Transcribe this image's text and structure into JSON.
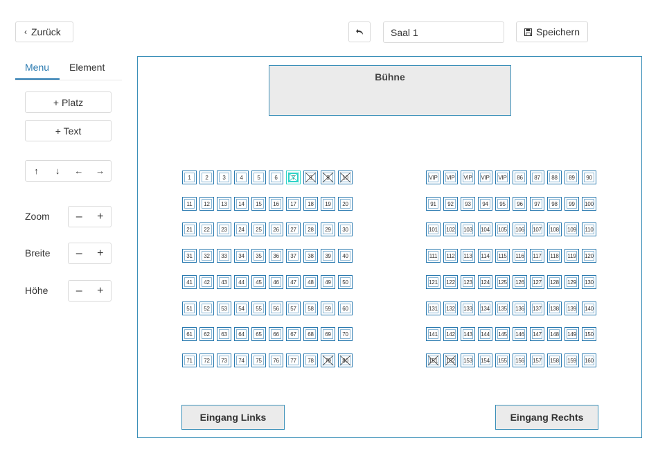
{
  "toolbar": {
    "back_label": "Zurück",
    "back_icon": "chevron-left-icon",
    "undo_icon": "undo-icon",
    "hall_name": "Saal 1",
    "save_label": "Speichern",
    "save_icon": "floppy-disk-icon"
  },
  "tabs": [
    {
      "label": "Menu",
      "active": true
    },
    {
      "label": "Element",
      "active": false
    }
  ],
  "sidebar": {
    "add_seat": "+ Platz",
    "add_text": "+ Text",
    "arrows": [
      "↑",
      "↓",
      "←",
      "→"
    ],
    "controls": [
      {
        "label": "Zoom",
        "minus": "–",
        "plus": "+"
      },
      {
        "label": "Breite",
        "minus": "–",
        "plus": "+"
      },
      {
        "label": "Höhe",
        "minus": "–",
        "plus": "+"
      }
    ]
  },
  "canvas": {
    "stage_label": "Bühne",
    "entrance_left": "Eingang Links",
    "entrance_right": "Eingang Rechts"
  },
  "seating": {
    "selected_color": "#2ed3c8",
    "border_color": "#2a7ab0",
    "left_block": [
      [
        "1",
        "2",
        "3",
        "4",
        "5",
        "6",
        "7",
        "8",
        "9",
        "10"
      ],
      [
        "11",
        "12",
        "13",
        "14",
        "15",
        "16",
        "17",
        "18",
        "19",
        "20"
      ],
      [
        "21",
        "22",
        "23",
        "24",
        "25",
        "26",
        "27",
        "28",
        "29",
        "30"
      ],
      [
        "31",
        "32",
        "33",
        "34",
        "35",
        "36",
        "37",
        "38",
        "39",
        "40"
      ],
      [
        "41",
        "42",
        "43",
        "44",
        "45",
        "46",
        "47",
        "48",
        "49",
        "50"
      ],
      [
        "51",
        "52",
        "53",
        "54",
        "55",
        "56",
        "57",
        "58",
        "59",
        "60"
      ],
      [
        "61",
        "62",
        "63",
        "64",
        "65",
        "66",
        "67",
        "68",
        "69",
        "70"
      ],
      [
        "71",
        "72",
        "73",
        "74",
        "75",
        "76",
        "77",
        "78",
        "79",
        "80"
      ]
    ],
    "right_block": [
      [
        "VIP",
        "VIP",
        "VIP",
        "VIP",
        "VIP",
        "86",
        "87",
        "88",
        "89",
        "90"
      ],
      [
        "91",
        "92",
        "93",
        "94",
        "95",
        "96",
        "97",
        "98",
        "99",
        "100"
      ],
      [
        "101",
        "102",
        "103",
        "104",
        "105",
        "106",
        "107",
        "108",
        "109",
        "110"
      ],
      [
        "111",
        "112",
        "113",
        "114",
        "115",
        "116",
        "117",
        "118",
        "119",
        "120"
      ],
      [
        "121",
        "122",
        "123",
        "124",
        "125",
        "126",
        "127",
        "128",
        "129",
        "130"
      ],
      [
        "131",
        "132",
        "133",
        "134",
        "135",
        "136",
        "137",
        "138",
        "139",
        "140"
      ],
      [
        "141",
        "142",
        "143",
        "144",
        "145",
        "146",
        "147",
        "148",
        "149",
        "150"
      ],
      [
        "151",
        "152",
        "153",
        "154",
        "155",
        "156",
        "157",
        "158",
        "159",
        "160"
      ]
    ],
    "blocked": [
      "7",
      "8",
      "9",
      "10",
      "79",
      "80",
      "151",
      "152"
    ],
    "selected": [
      "7"
    ]
  }
}
